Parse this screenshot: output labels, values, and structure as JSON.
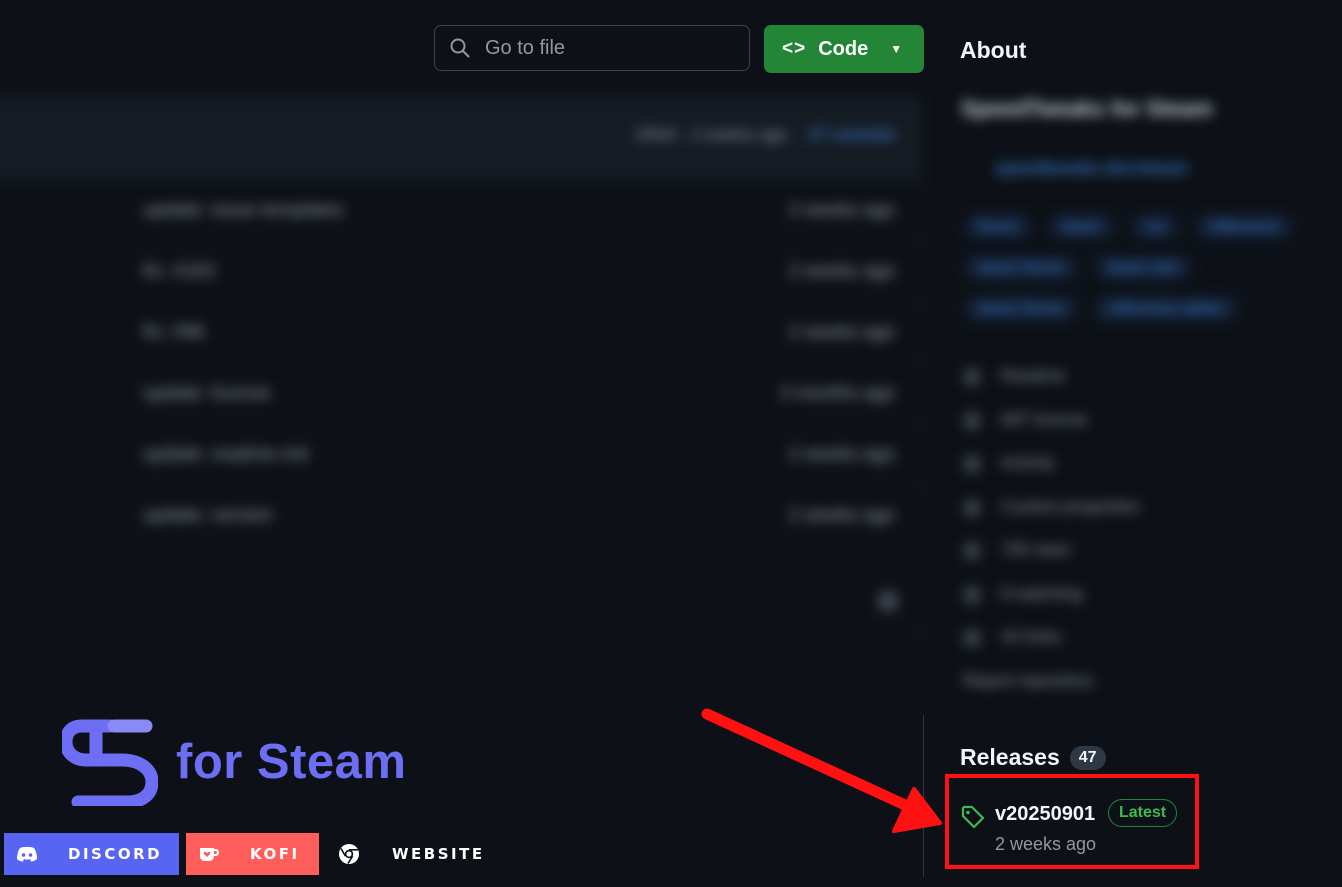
{
  "search": {
    "placeholder": "Go to file"
  },
  "code_button": {
    "brackets": "<>",
    "label": "Code"
  },
  "repo": {
    "latest_commit": {
      "hash": "1f0e0",
      "time": "2 weeks ago",
      "commits": "47 commits"
    },
    "files": [
      {
        "message": "update: issue templates",
        "time": "2 weeks ago"
      },
      {
        "message": "fix: #163",
        "time": "2 weeks ago"
      },
      {
        "message": "fix: #96",
        "time": "2 weeks ago"
      },
      {
        "message": "update: license",
        "time": "3 months ago"
      },
      {
        "message": "update: readme.md",
        "time": "2 weeks ago"
      },
      {
        "message": "update: version",
        "time": "2 weeks ago"
      }
    ]
  },
  "about": {
    "title": "About",
    "description": "SpeedTweaks for Steam",
    "website": "speedtweaks.dev/steam",
    "topics": [
      "theme",
      "steam",
      "css",
      "millennium",
      "steam-theme",
      "steam-skin",
      "steam-theme",
      "millennium-addon"
    ],
    "links": [
      "Readme",
      "MIT license",
      "Activity",
      "Custom properties",
      "705 stars",
      "8 watching",
      "42 forks",
      "Report repository"
    ]
  },
  "releases": {
    "title": "Releases",
    "count": "47",
    "latest": {
      "version": "v20250901",
      "badge": "Latest",
      "time": "2 weeks ago"
    }
  },
  "branding": {
    "text": "for Steam",
    "discord_label": "DISCORD",
    "kofi_label": "KOFI",
    "website_label": "WEBSITE"
  },
  "colors": {
    "background": "#0d1117",
    "code_button": "#238636",
    "highlight_box": "#ff1111",
    "brand_purple": "#6e6ef5",
    "discord": "#5865f2",
    "kofi": "#ff5e5b"
  },
  "icons": [
    "search-icon",
    "code-icon",
    "chevron-down-icon",
    "tag-icon",
    "discord-icon",
    "kofi-cup-icon",
    "chrome-icon",
    "st-logo-icon",
    "red-arrow-icon"
  ]
}
